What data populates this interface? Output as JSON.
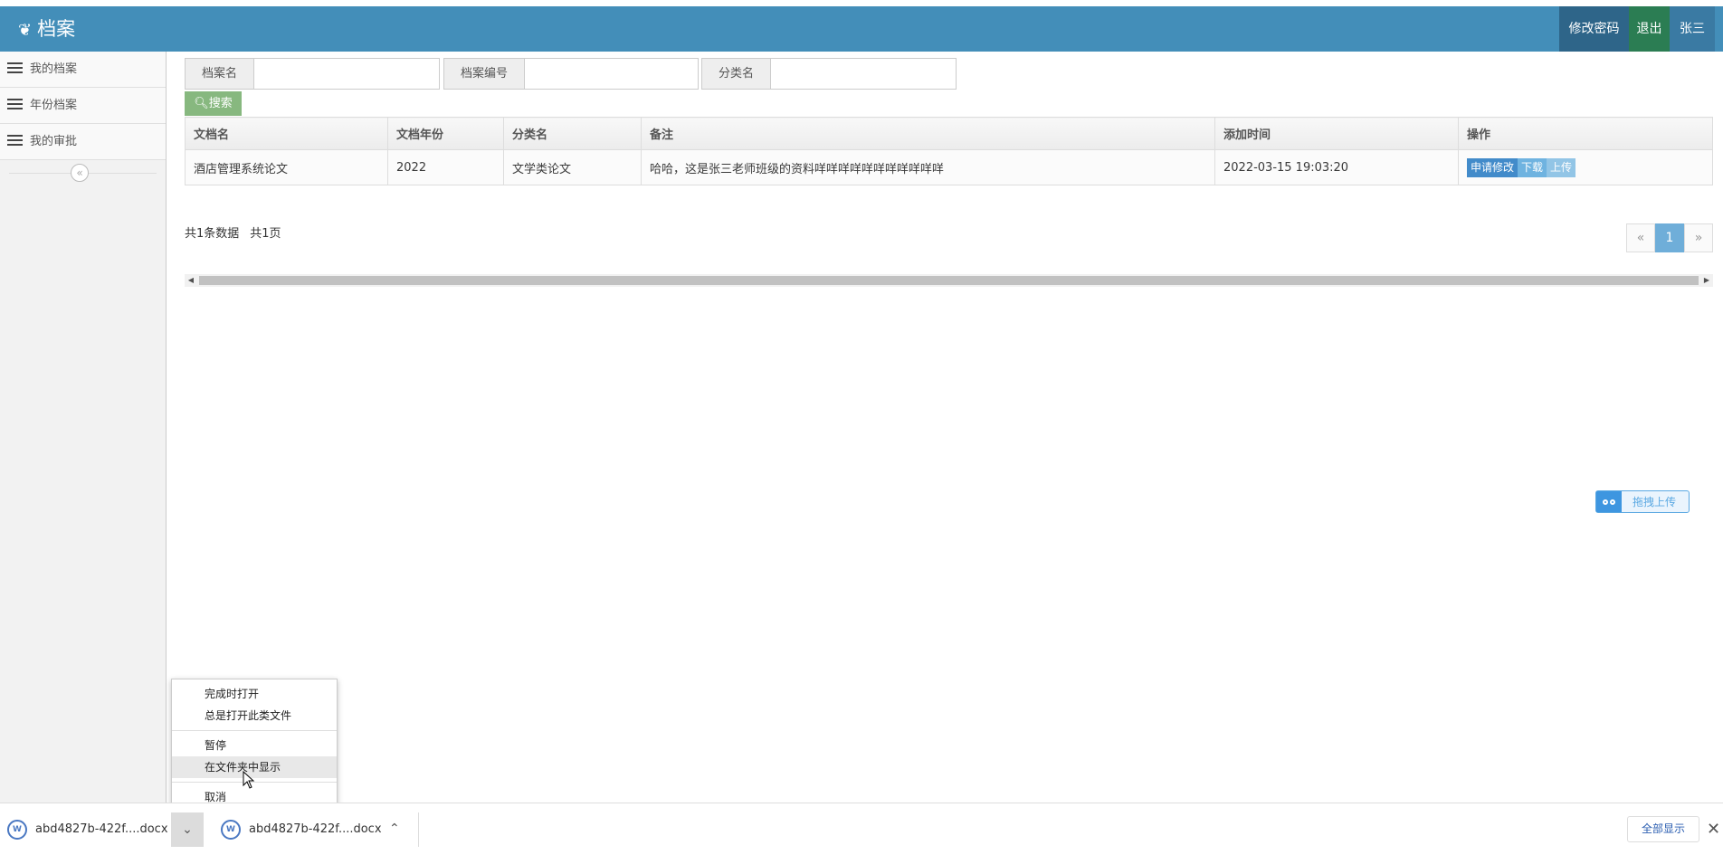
{
  "header": {
    "title": "档案",
    "change_password": "修改密码",
    "logout": "退出",
    "username": "张三",
    "colors": {
      "bar": "#438eb9",
      "password_btn": "#2e6589",
      "logout_btn": "#2b7d53"
    }
  },
  "sidebar": {
    "items": [
      {
        "label": "我的档案",
        "icon": "list-icon"
      },
      {
        "label": "年份档案",
        "icon": "list-icon"
      },
      {
        "label": "我的审批",
        "icon": "list-icon"
      }
    ],
    "collapse_icon": "«"
  },
  "search": {
    "fields": [
      {
        "label": "档案名",
        "value": ""
      },
      {
        "label": "档案编号",
        "value": ""
      },
      {
        "label": "分类名",
        "value": ""
      }
    ],
    "button": "搜索",
    "button_icon": "search-icon"
  },
  "table": {
    "columns": [
      "文档名",
      "文档年份",
      "分类名",
      "备注",
      "添加时间",
      "操作"
    ],
    "rows": [
      {
        "name": "酒店管理系统论文",
        "year": "2022",
        "category": "文学类论文",
        "note": "哈哈，这是张三老师班级的资料咩咩咩咩咩咩咩咩咩咩咩",
        "added": "2022-03-15 19:03:20",
        "actions": [
          "申请修改",
          "下载",
          "上传"
        ]
      }
    ]
  },
  "summary": {
    "total_records": "共1条数据",
    "total_pages": "共1页"
  },
  "pager": {
    "prev": "«",
    "current": "1",
    "next": "»"
  },
  "drag_upload": {
    "label": "拖拽上传"
  },
  "context_menu": {
    "items": [
      "完成时打开",
      "总是打开此类文件",
      "暂停",
      "在文件夹中显示",
      "取消"
    ],
    "hovered": "在文件夹中显示"
  },
  "downloads": {
    "items": [
      {
        "filename": "abd4827b-422f....docx"
      },
      {
        "filename": "abd4827b-422f....docx"
      }
    ],
    "show_all": "全部显示",
    "close": "✕"
  }
}
